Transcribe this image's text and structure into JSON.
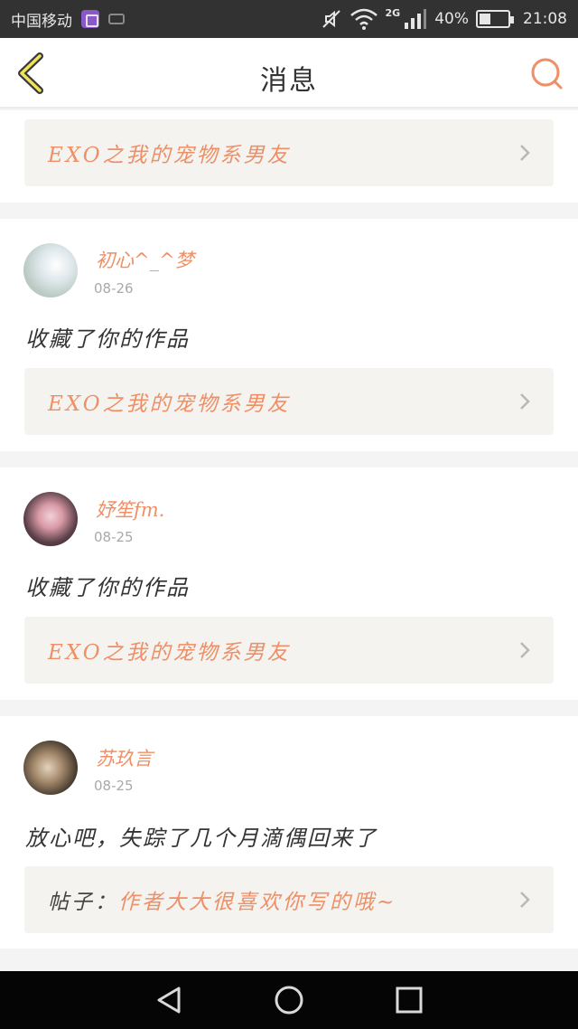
{
  "status_bar": {
    "carrier": "中国移动",
    "network": "2G",
    "battery": "40%",
    "time": "21:08",
    "icons": [
      "app-icon",
      "mini-icon",
      "mute-icon",
      "wifi-icon",
      "signal-icon",
      "battery-icon"
    ]
  },
  "header": {
    "title": "消息",
    "back_icon": "chevron-left-icon",
    "search_icon": "search-icon",
    "accent_color": "#ee8f66"
  },
  "messages": [
    {
      "link": {
        "prefix": "",
        "text": "EXO之我的宠物系男友"
      }
    },
    {
      "username": "初心^_^梦",
      "date": "08-26",
      "action": "收藏了你的作品",
      "link": {
        "prefix": "",
        "text": "EXO之我的宠物系男友"
      }
    },
    {
      "username": "妤笙fm.",
      "date": "08-25",
      "action": "收藏了你的作品",
      "link": {
        "prefix": "",
        "text": "EXO之我的宠物系男友"
      }
    },
    {
      "username": "苏玖言",
      "date": "08-25",
      "action": "放心吧，失踪了几个月滴偶回来了",
      "link": {
        "prefix": "帖子：",
        "text": "作者大大很喜欢你写的哦~"
      }
    }
  ],
  "nav_bar": {
    "icons": [
      "back-triangle-icon",
      "home-circle-icon",
      "recents-square-icon"
    ]
  }
}
